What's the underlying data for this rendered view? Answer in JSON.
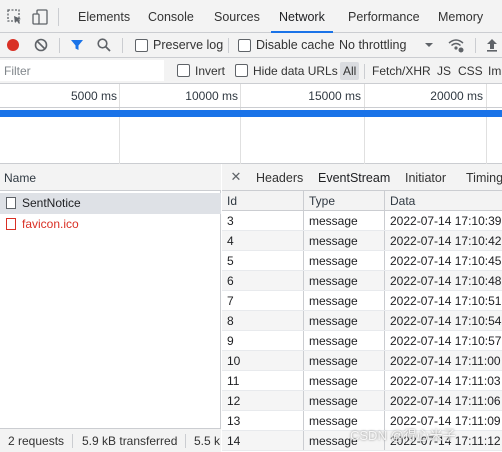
{
  "tabs": [
    "Elements",
    "Console",
    "Sources",
    "Network",
    "Performance",
    "Memory"
  ],
  "toolbar": {
    "preserve_log": "Preserve log",
    "disable_cache": "Disable cache",
    "throttling": "No throttling"
  },
  "filter": {
    "placeholder": "Filter",
    "invert": "Invert",
    "hide_data_urls": "Hide data URLs",
    "types": [
      "All",
      "Fetch/XHR",
      "JS",
      "CSS",
      "Im"
    ]
  },
  "timeline": {
    "ticks": [
      "5000 ms",
      "10000 ms",
      "15000 ms",
      "20000 ms"
    ]
  },
  "requests": {
    "header": "Name",
    "items": [
      {
        "name": "SentNotice"
      },
      {
        "name": "favicon.ico"
      }
    ],
    "status": {
      "requests": "2 requests",
      "transferred": "5.9 kB transferred",
      "resources": "5.5 k"
    }
  },
  "details": {
    "tabs": [
      "Headers",
      "EventStream",
      "Initiator",
      "Timing"
    ],
    "columns": [
      "Id",
      "Type",
      "Data"
    ],
    "events": [
      {
        "id": "3",
        "type": "message",
        "data": "2022-07-14 17:10:39"
      },
      {
        "id": "4",
        "type": "message",
        "data": "2022-07-14 17:10:42"
      },
      {
        "id": "5",
        "type": "message",
        "data": "2022-07-14 17:10:45"
      },
      {
        "id": "6",
        "type": "message",
        "data": "2022-07-14 17:10:48"
      },
      {
        "id": "7",
        "type": "message",
        "data": "2022-07-14 17:10:51"
      },
      {
        "id": "8",
        "type": "message",
        "data": "2022-07-14 17:10:54"
      },
      {
        "id": "9",
        "type": "message",
        "data": "2022-07-14 17:10:57"
      },
      {
        "id": "10",
        "type": "message",
        "data": "2022-07-14 17:11:00"
      },
      {
        "id": "11",
        "type": "message",
        "data": "2022-07-14 17:11:03"
      },
      {
        "id": "12",
        "type": "message",
        "data": "2022-07-14 17:11:06"
      },
      {
        "id": "13",
        "type": "message",
        "data": "2022-07-14 17:11:09"
      },
      {
        "id": "14",
        "type": "message",
        "data": "2022-07-14 17:11:12"
      }
    ]
  },
  "watermark": "CSDN @得心米子"
}
